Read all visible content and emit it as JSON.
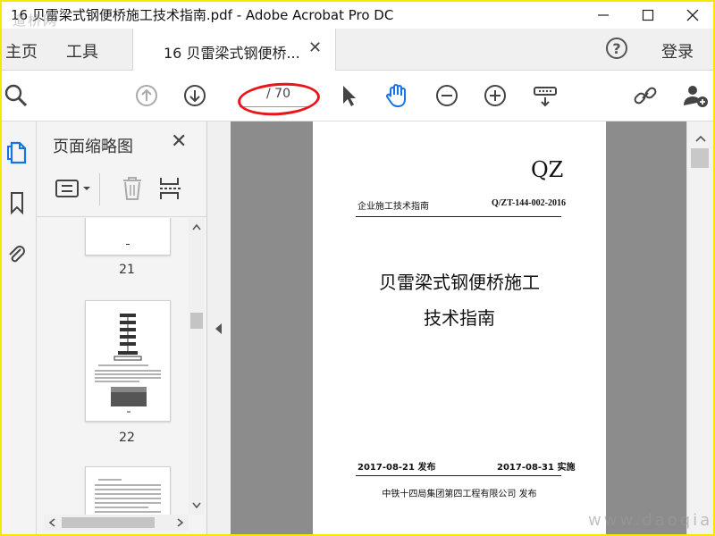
{
  "window": {
    "title": "16 贝雷梁式钢便桥施工技术指南.pdf - Adobe Acrobat Pro DC",
    "watermark_top": "道桥网",
    "watermark_bottom": "www.daoqiaow.com"
  },
  "tabs": {
    "home": "主页",
    "tools": "工具",
    "document": "16 贝雷梁式钢便桥...",
    "help": "?",
    "login": "登录"
  },
  "toolbar": {
    "page_current": "",
    "page_total": "/ 70"
  },
  "panel": {
    "title": "页面缩略图",
    "thumbnails": [
      {
        "number": "21"
      },
      {
        "number": "22"
      }
    ]
  },
  "document": {
    "header_code": "QZ",
    "standard_type": "企业施工技术指南",
    "standard_number": "Q/ZT-144-002-2016",
    "title_line1": "贝雷梁式钢便桥施工",
    "title_line2": "技术指南",
    "publish_date": "2017-08-21 发布",
    "implement_date": "2017-08-31 实施",
    "publisher": "中铁十四局集团第四工程有限公司 发布"
  },
  "colors": {
    "annotation_red": "#e8161b",
    "frame_yellow": "#f7e600",
    "acrobat_blue": "#1473e6"
  }
}
